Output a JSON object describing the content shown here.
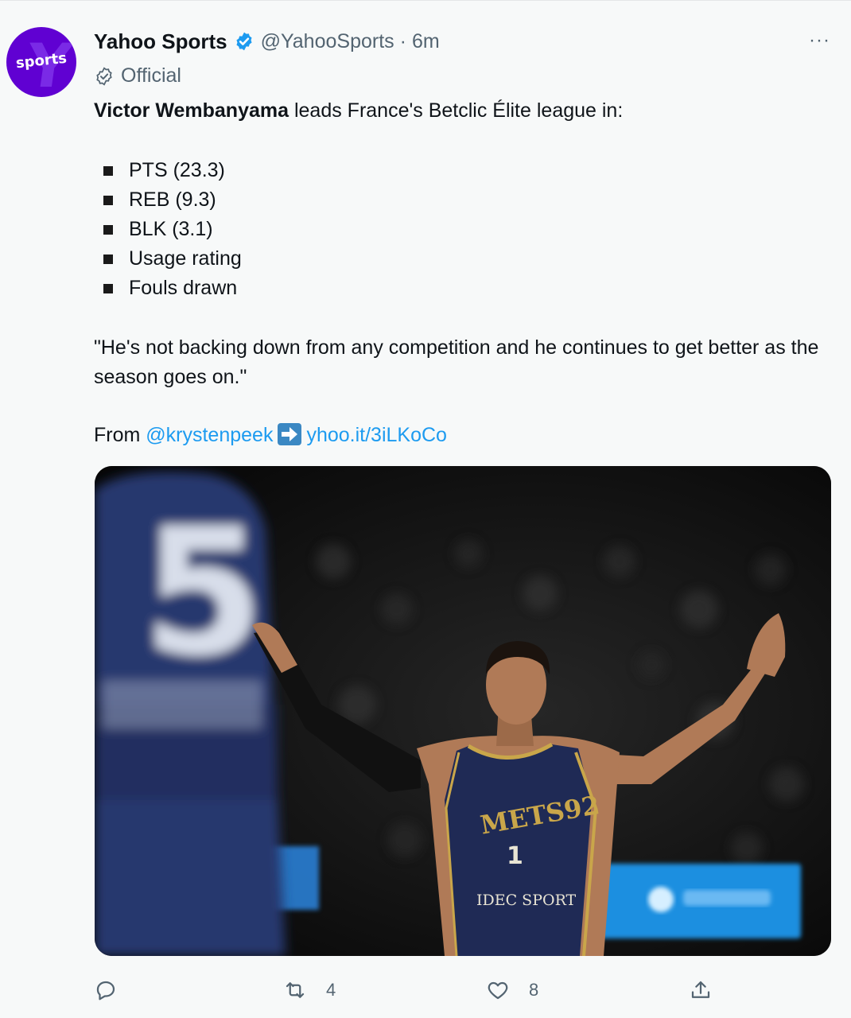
{
  "tweet": {
    "author_name": "Yahoo Sports",
    "handle": "@YahooSports",
    "separator": "·",
    "time": "6m",
    "official_label": "Official",
    "avatar_text": "sports",
    "avatar_letter": "Y!",
    "more_label": "···",
    "intro_bold": "Victor Wembanyama",
    "intro_rest": " leads France's Betclic Élite league in:",
    "stats": [
      "PTS (23.3)",
      "REB (9.3)",
      "BLK (3.1)",
      "Usage rating",
      "Fouls drawn"
    ],
    "quote": "\"He's not backing down from any competition and he continues to get better as the season goes on.\"",
    "from_label": "From ",
    "mention": "@krystenpeek",
    "short_link": "yhoo.it/3iLKoCo"
  },
  "photo": {
    "jersey_team": "METS92",
    "jersey_number": "1",
    "jersey_sponsor": "IDEC SPORT",
    "foreground_number": "5"
  },
  "actions": {
    "reply_count": "",
    "retweet_count": "4",
    "like_count": "8"
  },
  "colors": {
    "avatar_bg": "#6001d2",
    "verified": "#1d9bf0",
    "link": "#1d9bf0",
    "muted_text": "#536471",
    "jersey_navy": "#1f2a55",
    "jersey_gold": "#c9a64a"
  }
}
